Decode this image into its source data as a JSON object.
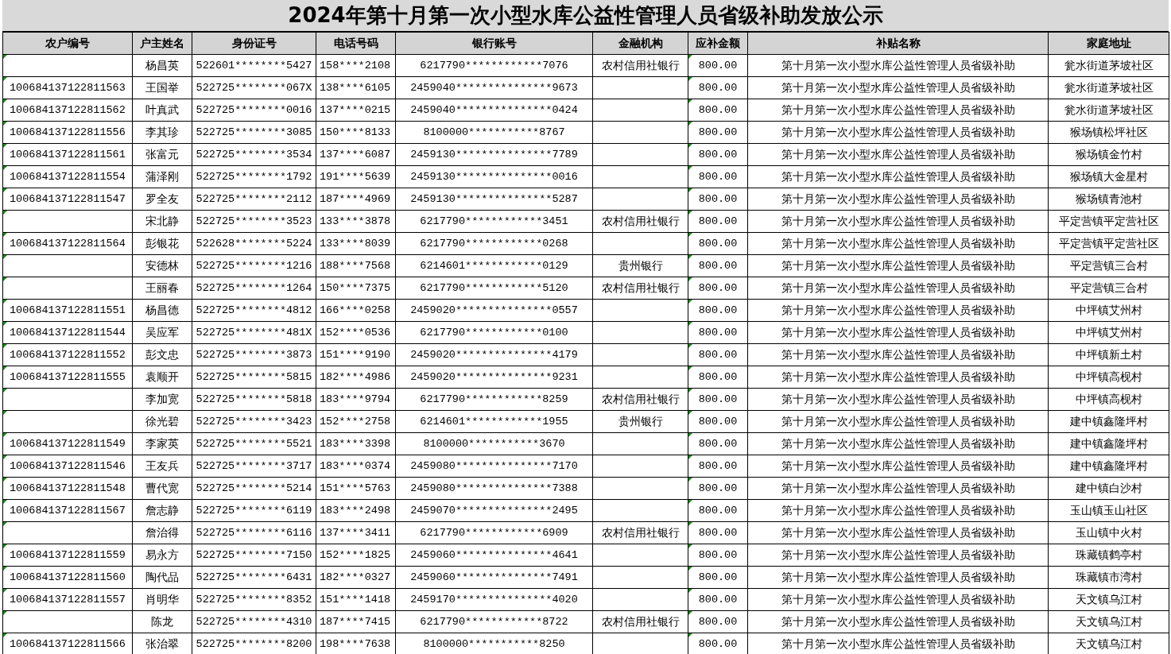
{
  "title": "2024年第十月第一次小型水库公益性管理人员省级补助发放公示",
  "columns": [
    {
      "label": "农户编号",
      "flagged": true
    },
    {
      "label": "户主姓名",
      "flagged": false
    },
    {
      "label": "身份证号",
      "flagged": false
    },
    {
      "label": "电话号码",
      "flagged": false
    },
    {
      "label": "银行账号",
      "flagged": false
    },
    {
      "label": "金融机构",
      "flagged": false
    },
    {
      "label": "应补金额",
      "flagged": true
    },
    {
      "label": "补贴名称",
      "flagged": false
    },
    {
      "label": "家庭地址",
      "flagged": false
    }
  ],
  "rows": [
    {
      "name": "杨昌英",
      "id_number": "522601********5427",
      "phone": "158****2108",
      "bank_account": "6217790************7076",
      "institution": "农村信用社银行",
      "amount": "800.00",
      "subsidy": "第十月第一次小型水库公益性管理人员省级补助",
      "address": "瓮水街道茅坡社区"
    },
    {
      "household_no": "100684137122811563",
      "name": "王国举",
      "id_number": "522725********067X",
      "phone": "138****6105",
      "bank_account": "2459040***************9673",
      "amount": "800.00",
      "subsidy": "第十月第一次小型水库公益性管理人员省级补助",
      "address": "瓮水街道茅坡社区"
    },
    {
      "household_no": "100684137122811562",
      "name": "叶真武",
      "id_number": "522725********0016",
      "phone": "137****0215",
      "bank_account": "2459040***************0424",
      "amount": "800.00",
      "subsidy": "第十月第一次小型水库公益性管理人员省级补助",
      "address": "瓮水街道茅坡社区"
    },
    {
      "household_no": "100684137122811556",
      "name": "李其珍",
      "id_number": "522725********3085",
      "phone": "150****8133",
      "bank_account": "8100000***********8767",
      "amount": "800.00",
      "subsidy": "第十月第一次小型水库公益性管理人员省级补助",
      "address": "猴场镇松坪社区"
    },
    {
      "household_no": "100684137122811561",
      "name": "张富元",
      "id_number": "522725********3534",
      "phone": "137****6087",
      "bank_account": "2459130***************7789",
      "amount": "800.00",
      "subsidy": "第十月第一次小型水库公益性管理人员省级补助",
      "address": "猴场镇金竹村"
    },
    {
      "household_no": "100684137122811554",
      "name": "蒲泽刚",
      "id_number": "522725********1792",
      "phone": "191****5639",
      "bank_account": "2459130***************0016",
      "amount": "800.00",
      "subsidy": "第十月第一次小型水库公益性管理人员省级补助",
      "address": "猴场镇大金星村"
    },
    {
      "household_no": "100684137122811547",
      "name": "罗全友",
      "id_number": "522725********2112",
      "phone": "187****4969",
      "bank_account": "2459130***************5287",
      "amount": "800.00",
      "subsidy": "第十月第一次小型水库公益性管理人员省级补助",
      "address": "猴场镇青池村"
    },
    {
      "name": "宋北静",
      "id_number": "522725********3523",
      "phone": "133****3878",
      "bank_account": "6217790************3451",
      "institution": "农村信用社银行",
      "amount": "800.00",
      "subsidy": "第十月第一次小型水库公益性管理人员省级补助",
      "address": "平定营镇平定营社区"
    },
    {
      "household_no": "100684137122811564",
      "name": "彭银花",
      "id_number": "522628********5224",
      "phone": "133****8039",
      "bank_account": "6217790************0268",
      "amount": "800.00",
      "subsidy": "第十月第一次小型水库公益性管理人员省级补助",
      "address": "平定营镇平定营社区"
    },
    {
      "name": "安德林",
      "id_number": "522725********1216",
      "phone": "188****7568",
      "bank_account": "6214601************0129",
      "institution": "贵州银行",
      "amount": "800.00",
      "subsidy": "第十月第一次小型水库公益性管理人员省级补助",
      "address": "平定营镇三合村"
    },
    {
      "name": "王丽春",
      "id_number": "522725********1264",
      "phone": "150****7375",
      "bank_account": "6217790************5120",
      "institution": "农村信用社银行",
      "amount": "800.00",
      "subsidy": "第十月第一次小型水库公益性管理人员省级补助",
      "address": "平定营镇三合村"
    },
    {
      "household_no": "100684137122811551",
      "name": "杨昌德",
      "id_number": "522725********4812",
      "phone": "166****0258",
      "bank_account": "2459020***************0557",
      "amount": "800.00",
      "subsidy": "第十月第一次小型水库公益性管理人员省级补助",
      "address": "中坪镇艾州村"
    },
    {
      "household_no": "100684137122811544",
      "name": "吴应军",
      "id_number": "522725********481X",
      "phone": "152****0536",
      "bank_account": "6217790************0100",
      "amount": "800.00",
      "subsidy": "第十月第一次小型水库公益性管理人员省级补助",
      "address": "中坪镇艾州村"
    },
    {
      "household_no": "100684137122811552",
      "name": "彭文忠",
      "id_number": "522725********3873",
      "phone": "151****9190",
      "bank_account": "2459020***************4179",
      "amount": "800.00",
      "subsidy": "第十月第一次小型水库公益性管理人员省级补助",
      "address": "中坪镇新土村"
    },
    {
      "household_no": "100684137122811555",
      "name": "袁顺开",
      "id_number": "522725********5815",
      "phone": "182****4986",
      "bank_account": "2459020***************9231",
      "amount": "800.00",
      "subsidy": "第十月第一次小型水库公益性管理人员省级补助",
      "address": "中坪镇高枧村"
    },
    {
      "name": "李加宽",
      "id_number": "522725********5818",
      "phone": "183****9794",
      "bank_account": "6217790************8259",
      "institution": "农村信用社银行",
      "amount": "800.00",
      "subsidy": "第十月第一次小型水库公益性管理人员省级补助",
      "address": "中坪镇高枧村"
    },
    {
      "name": "徐光碧",
      "id_number": "522725********3423",
      "phone": "152****2758",
      "bank_account": "6214601************1955",
      "institution": "贵州银行",
      "amount": "800.00",
      "subsidy": "第十月第一次小型水库公益性管理人员省级补助",
      "address": "建中镇鑫隆坪村"
    },
    {
      "household_no": "100684137122811549",
      "name": "李家英",
      "id_number": "522725********5521",
      "phone": "183****3398",
      "bank_account": "8100000***********3670",
      "amount": "800.00",
      "subsidy": "第十月第一次小型水库公益性管理人员省级补助",
      "address": "建中镇鑫隆坪村"
    },
    {
      "household_no": "100684137122811546",
      "name": "王友兵",
      "id_number": "522725********3717",
      "phone": "183****0374",
      "bank_account": "2459080***************7170",
      "amount": "800.00",
      "subsidy": "第十月第一次小型水库公益性管理人员省级补助",
      "address": "建中镇鑫隆坪村"
    },
    {
      "household_no": "100684137122811548",
      "name": "曹代宽",
      "id_number": "522725********5214",
      "phone": "151****5763",
      "bank_account": "2459080***************7388",
      "amount": "800.00",
      "subsidy": "第十月第一次小型水库公益性管理人员省级补助",
      "address": "建中镇白沙村"
    },
    {
      "household_no": "100684137122811567",
      "name": "詹志静",
      "id_number": "522725********6119",
      "phone": "183****2498",
      "bank_account": "2459070***************2495",
      "amount": "800.00",
      "subsidy": "第十月第一次小型水库公益性管理人员省级补助",
      "address": "玉山镇玉山社区"
    },
    {
      "name": "詹治得",
      "id_number": "522725********6116",
      "phone": "137****3411",
      "bank_account": "6217790************6909",
      "institution": "农村信用社银行",
      "amount": "800.00",
      "subsidy": "第十月第一次小型水库公益性管理人员省级补助",
      "address": "玉山镇中火村"
    },
    {
      "household_no": "100684137122811559",
      "name": "易永方",
      "id_number": "522725********7150",
      "phone": "152****1825",
      "bank_account": "2459060***************4641",
      "amount": "800.00",
      "subsidy": "第十月第一次小型水库公益性管理人员省级补助",
      "address": "珠藏镇鹤亭村"
    },
    {
      "household_no": "100684137122811560",
      "name": "陶代品",
      "id_number": "522725********6431",
      "phone": "182****0327",
      "bank_account": "2459060***************7491",
      "amount": "800.00",
      "subsidy": "第十月第一次小型水库公益性管理人员省级补助",
      "address": "珠藏镇市湾村"
    },
    {
      "household_no": "100684137122811557",
      "name": "肖明华",
      "id_number": "522725********8352",
      "phone": "151****1418",
      "bank_account": "2459170***************4020",
      "amount": "800.00",
      "subsidy": "第十月第一次小型水库公益性管理人员省级补助",
      "address": "天文镇乌江村"
    },
    {
      "name": "陈龙",
      "id_number": "522725********4310",
      "phone": "187****7415",
      "bank_account": "6217790************8722",
      "institution": "农村信用社银行",
      "amount": "800.00",
      "subsidy": "第十月第一次小型水库公益性管理人员省级补助",
      "address": "天文镇乌江村"
    },
    {
      "household_no": "100684137122811566",
      "name": "张治翠",
      "id_number": "522725********8200",
      "phone": "198****7638",
      "bank_account": "8100000***********8250",
      "amount": "800.00",
      "subsidy": "第十月第一次小型水库公益性管理人员省级补助",
      "address": "天文镇乌江村"
    }
  ]
}
